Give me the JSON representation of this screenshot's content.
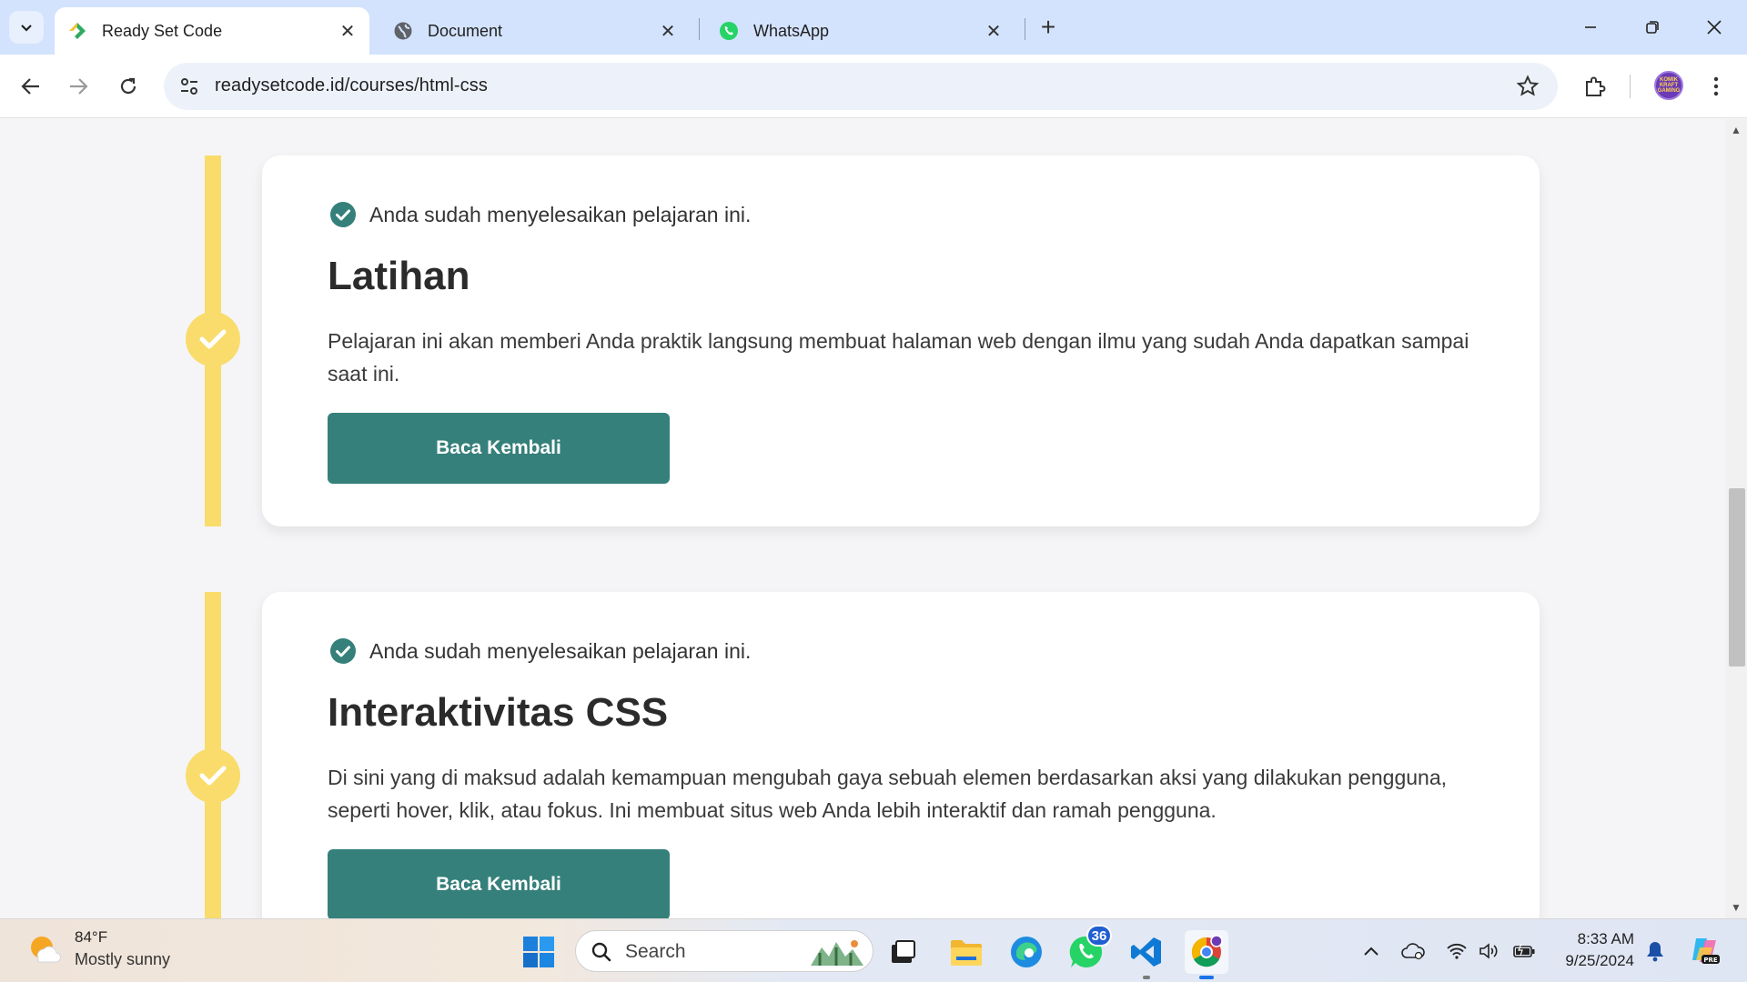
{
  "browser": {
    "tabs": [
      {
        "label": "Ready Set Code",
        "active": true,
        "icon": "readysetcode-logo-icon"
      },
      {
        "label": "Document",
        "active": false,
        "icon": "globe-icon"
      },
      {
        "label": "WhatsApp",
        "active": false,
        "icon": "whatsapp-icon"
      }
    ],
    "url": "readysetcode.id/courses/html-css",
    "profile_badge": "KOMIK\nKRAFT\nGAMING"
  },
  "lessons": [
    {
      "status": "Anda sudah menyelesaikan pelajaran ini.",
      "title": "Latihan",
      "description": "Pelajaran ini akan memberi Anda praktik langsung membuat halaman web dengan ilmu yang sudah Anda dapatkan sampai saat ini.",
      "button": "Baca Kembali"
    },
    {
      "status": "Anda sudah menyelesaikan pelajaran ini.",
      "title": "Interaktivitas CSS",
      "description": "Di sini yang di maksud adalah kemampuan mengubah gaya sebuah elemen berdasarkan aksi yang dilakukan pengguna, seperti hover, klik, atau fokus. Ini membuat situs web Anda lebih interaktif dan ramah pengguna.",
      "button": "Baca Kembali"
    }
  ],
  "taskbar": {
    "weather_temp": "84°F",
    "weather_desc": "Mostly sunny",
    "search_label": "Search",
    "whatsapp_badge": "36",
    "time": "8:33 AM",
    "date": "9/25/2024"
  },
  "colors": {
    "accent_teal": "#35807a",
    "timeline_yellow": "#f9dc6c",
    "tabstrip": "#d3e3fd"
  }
}
